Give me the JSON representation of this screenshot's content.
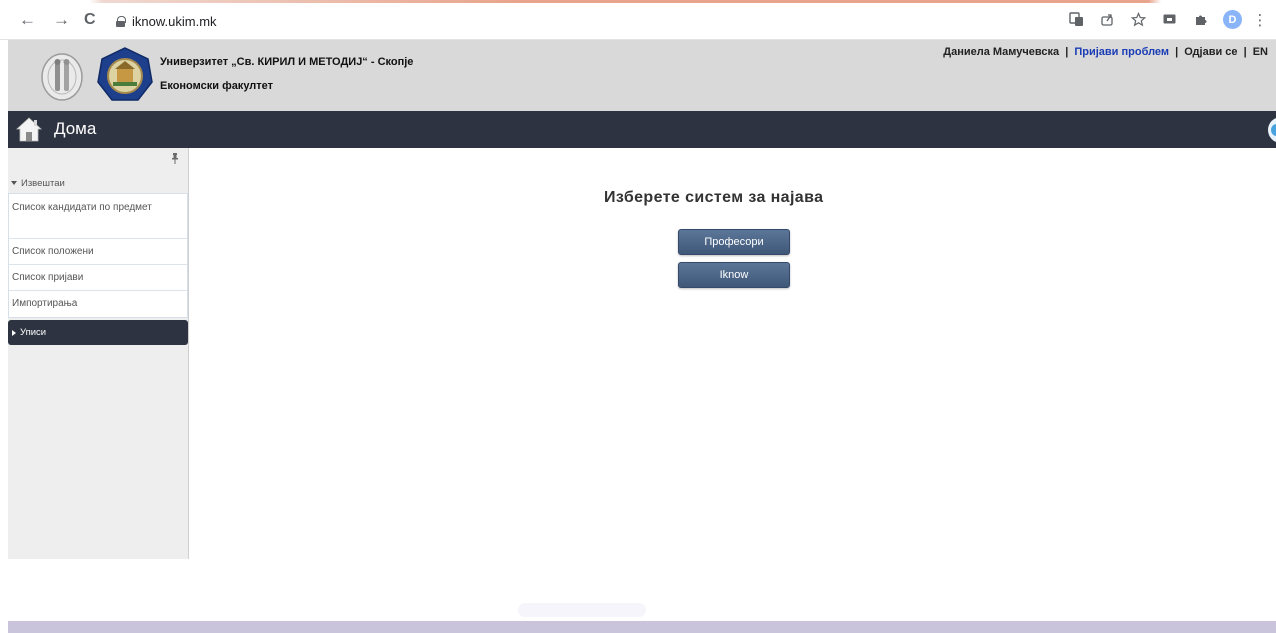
{
  "browser": {
    "url": "iknow.ukim.mk",
    "nav": {
      "back": "←",
      "forward": "→",
      "reload": "C"
    },
    "extensions": [
      "translate-icon",
      "share-icon",
      "star-icon",
      "cast-icon",
      "puzzle-icon"
    ],
    "profile_initial": "D",
    "menu": "⋮"
  },
  "header": {
    "university": "Универзитет „Св. КИРИЛ И МЕТОДИЈ“ - Скопје",
    "faculty": "Економски факултет",
    "user_name": "Даниела Мамучевска",
    "separator": "|",
    "report_problem": "Пријави проблем",
    "logout": "Одјави се",
    "language": "EN",
    "link_color": "#1a3db5"
  },
  "home_bar": {
    "label": "Дома",
    "background": "#2d3340"
  },
  "sidebar": {
    "reports_section": "Извештаи",
    "items": [
      "Список кандидати по предмет",
      "Список положени",
      "Список пријави",
      "Импортирања"
    ],
    "enrollments_section": "Уписи"
  },
  "main": {
    "title": "Изберете систем за најава",
    "buttons": {
      "professors": "Професори",
      "iknow": "Iknow"
    },
    "button_color": "#4a6384"
  },
  "footer": {
    "background": "#c9c4dc"
  }
}
